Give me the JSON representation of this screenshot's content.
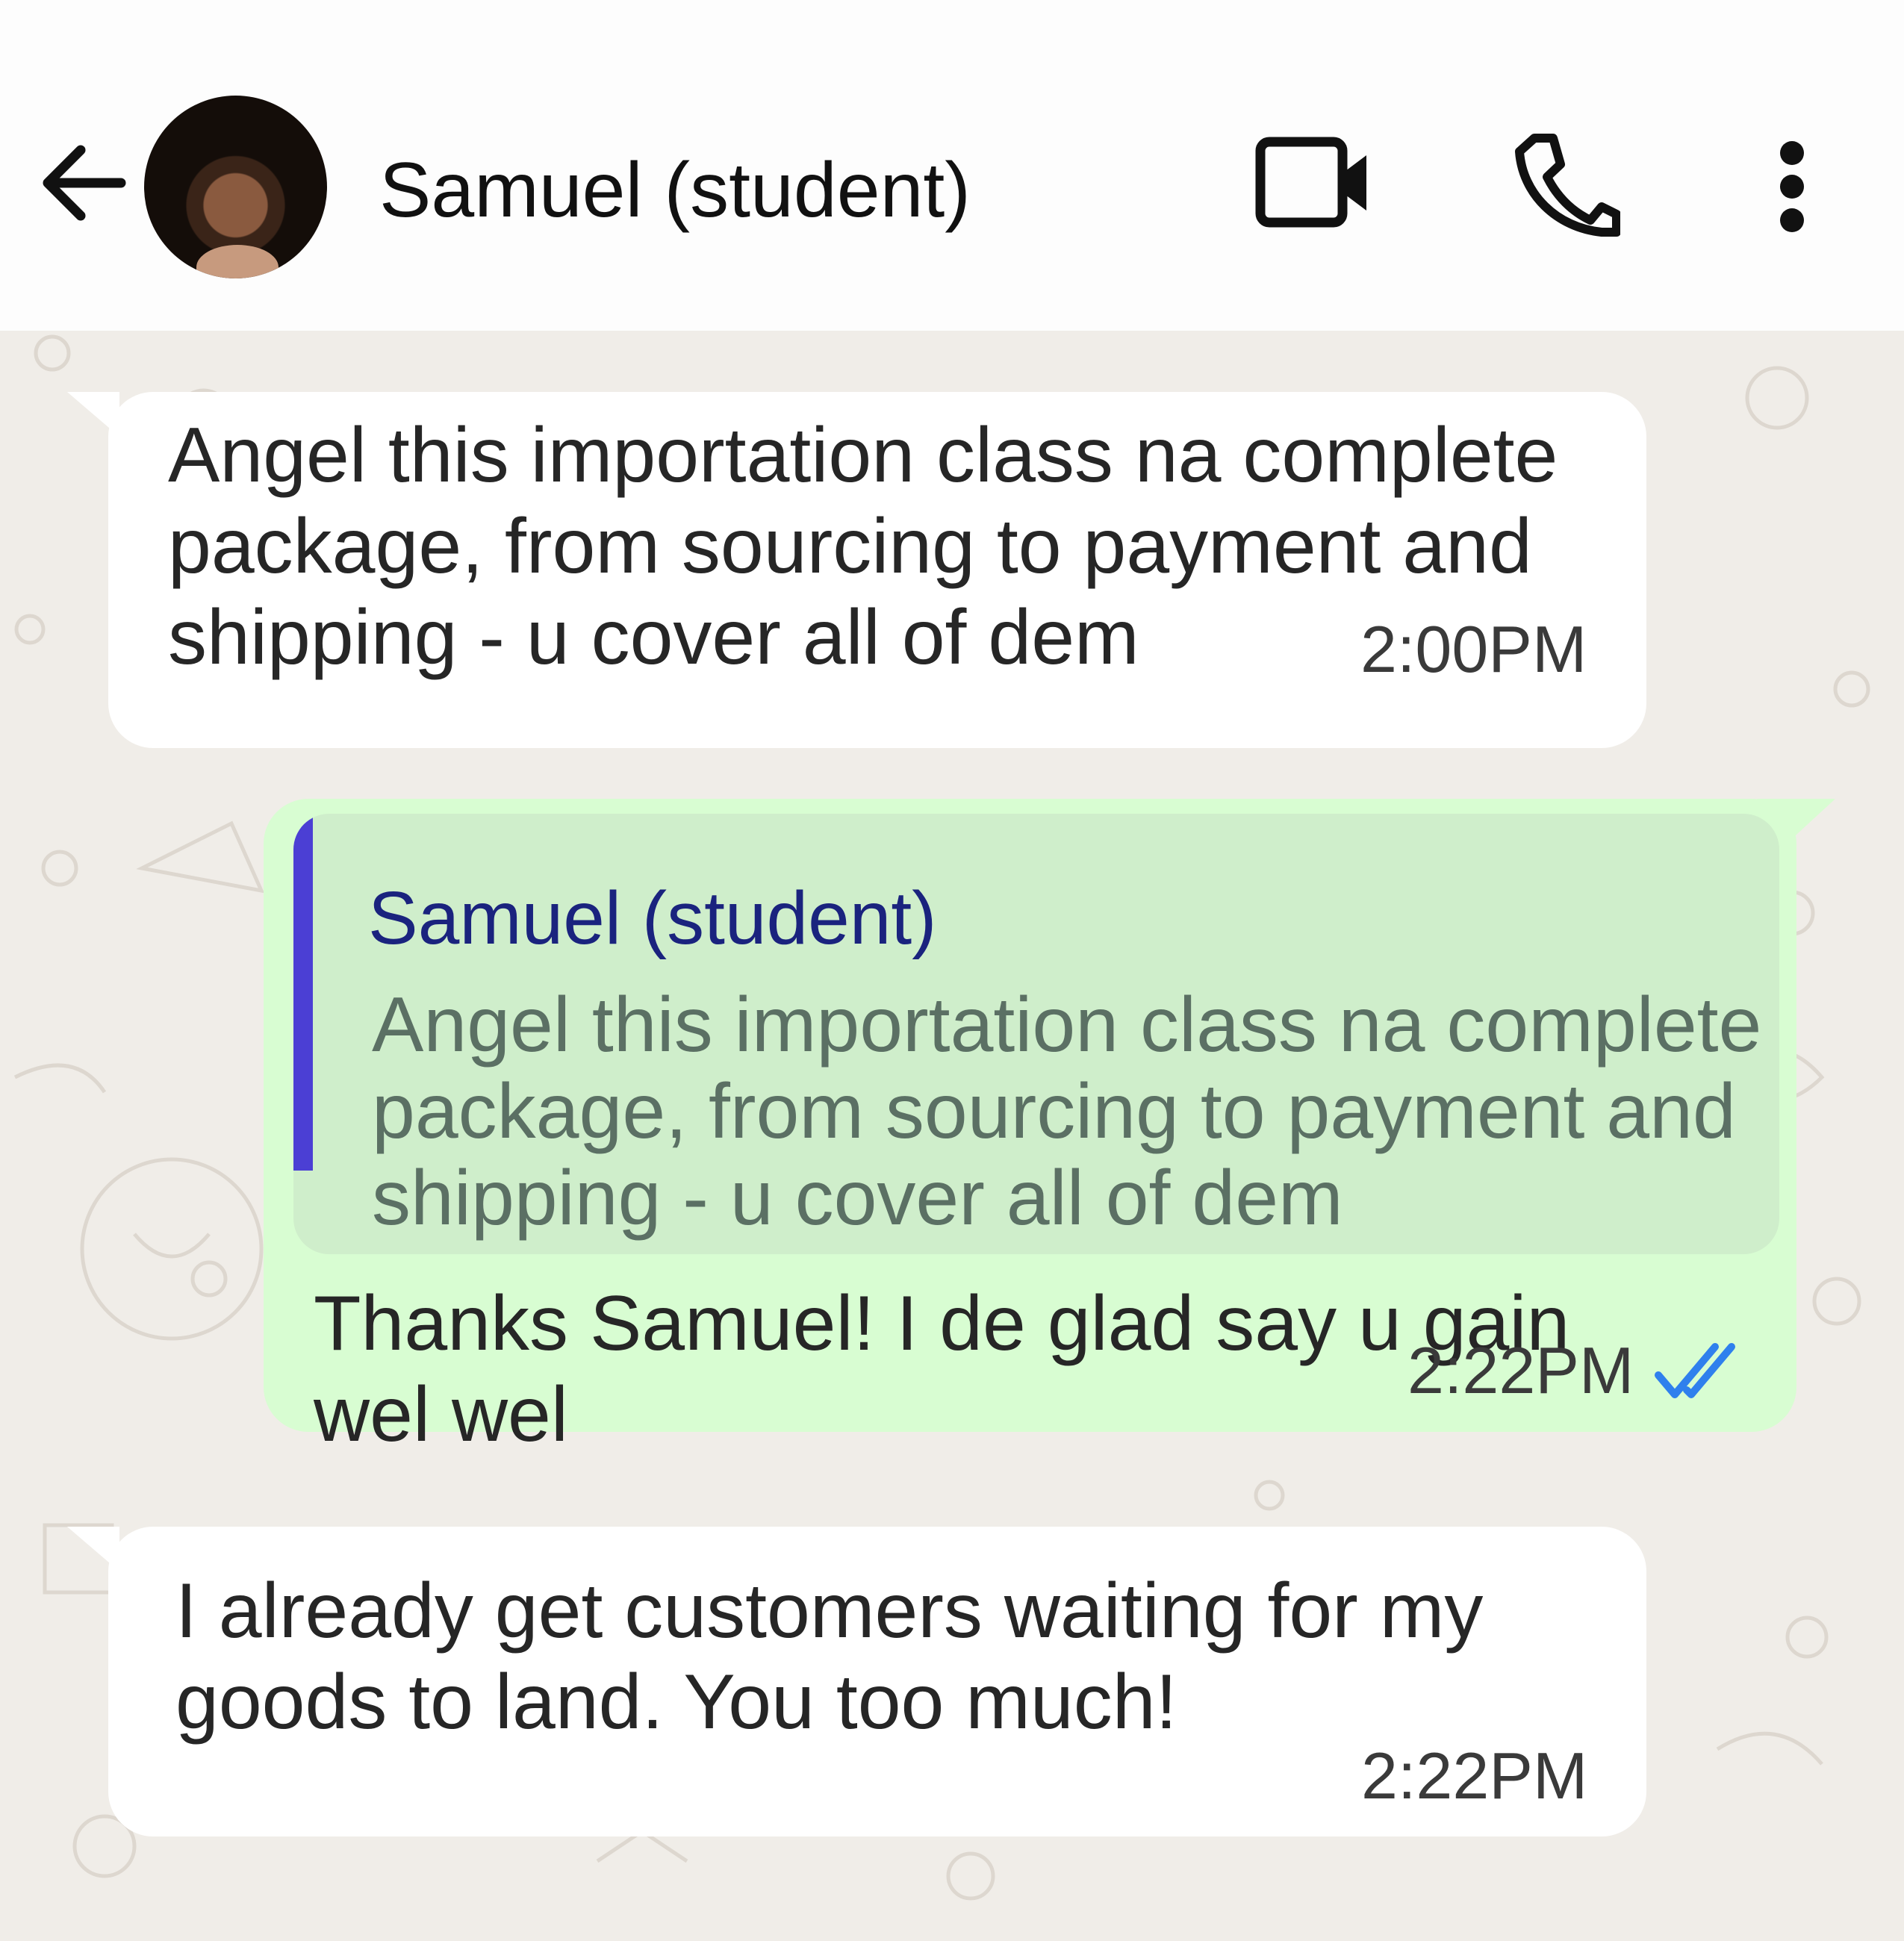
{
  "header": {
    "contact_name": "Samuel (student)",
    "icons": [
      "back-arrow-icon",
      "avatar",
      "video-call-icon",
      "phone-call-icon",
      "more-options-icon"
    ]
  },
  "messages": [
    {
      "direction": "incoming",
      "text": "Angel this importation class na complete\npackage, from sourcing to payment and\nshipping - u cover all of dem",
      "time": "2:00PM"
    },
    {
      "direction": "outgoing",
      "quote": {
        "author": "Samuel (student)",
        "text": "Angel this importation class na complete\npackage, from sourcing to payment and\nshipping - u cover all of dem"
      },
      "text": "Thanks Samuel! I de glad say u gain\nwel wel",
      "time": "2:22PM",
      "status": "read",
      "status_icon": "double-check-icon"
    },
    {
      "direction": "incoming",
      "text": "I already get customers waiting for my\ngoods to land. You too much!",
      "time": "2:22PM"
    }
  ],
  "colors": {
    "incoming_bubble": "#ffffff",
    "outgoing_bubble": "#d8fdd2",
    "quote_background": "#cfeecb",
    "quote_bar": "#4b3fd4",
    "quote_author": "#1a237e",
    "read_ticks": "#2f80ed",
    "chat_background": "#f0ede8"
  }
}
